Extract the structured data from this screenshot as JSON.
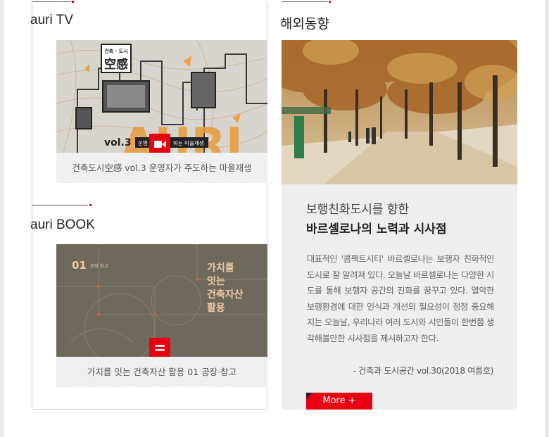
{
  "auri_tv": {
    "title": "auri TV",
    "poster_heading": "건축 · 도시",
    "poster_title": "空感",
    "poster_vol": "vol.3",
    "poster_sub_a": "운영",
    "poster_sub_b": "하는 마을재생",
    "caption": "건축도시空感 vol.3 운영자가 주도하는 마을재생"
  },
  "auri_book": {
    "title": "auri BOOK",
    "cover_number": "01",
    "cover_tag": "공장·창고",
    "cover_title": [
      "가치를",
      "잇는",
      "건축자산",
      "활용"
    ],
    "caption": "가치를 잇는 건축자산 활용 01 공장·창고"
  },
  "overseas": {
    "title": "해외동향",
    "subtitle": "보행친화도시를 향한",
    "headline": "바르셀로나의 노력과 시사점",
    "body": "대표적인 '콤팩트시티' 바르셀로나는 보행자 친화적인 도시로 잘 알려져 있다. 오늘날 바르셀로나는 다양한 시도를 통해 보행자 공간의 진화를 꿈꾸고 있다. 열악한 보행환경에 대한 인식과 개선의 필요성이 점점 중요해지는 오늘날, 우리나라 여러 도시와 시민들이 한번쯤 생각해볼만한 시사점을 제시하고자 한다.",
    "source": "- 건축과 도시공간 vol.30(2018 여름호)",
    "more_label": "More +"
  },
  "colors": {
    "accent": "#e60012",
    "panel": "#eeeeee"
  },
  "icons": {
    "tv_badge": "video-camera-icon",
    "book_badge": "book-lines-icon"
  }
}
